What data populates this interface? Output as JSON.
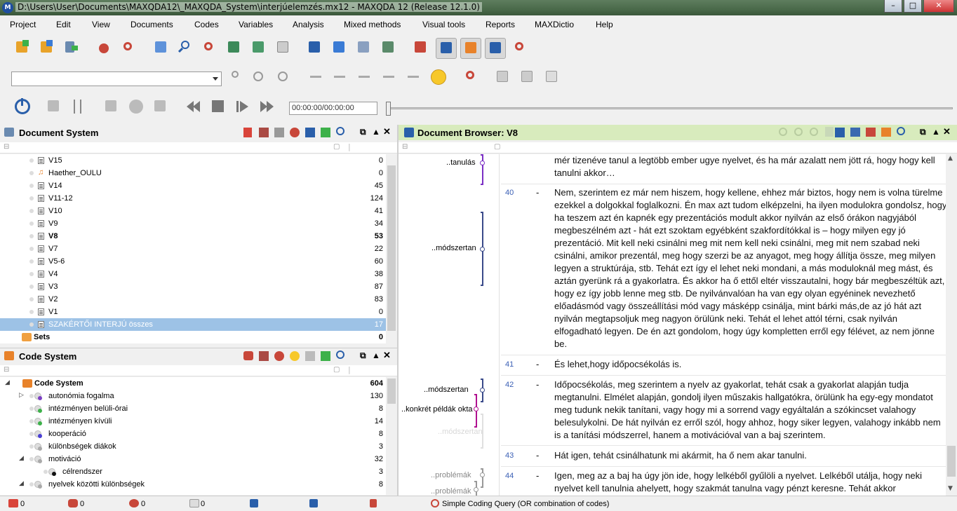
{
  "window": {
    "title": "D:\\Users\\User\\Documents\\MAXQDA12\\_MAXQDA_System\\interjúelemzés.mx12 - MAXQDA 12  (Release 12.1.0)",
    "minimize": "–",
    "maximize": "□",
    "close": "✕"
  },
  "menu": [
    "Project",
    "Edit",
    "View",
    "Documents",
    "Codes",
    "Variables",
    "Analysis",
    "Mixed methods",
    "Visual tools",
    "Reports",
    "MAXDictio",
    "Help"
  ],
  "media": {
    "time": "00:00:00/00:00:00",
    "progress": 0
  },
  "document_system": {
    "title": "Document System",
    "rows": [
      {
        "label": "V15",
        "count": "0"
      },
      {
        "label": "Haether_OULU",
        "count": "0",
        "audio": true
      },
      {
        "label": "V14",
        "count": "45"
      },
      {
        "label": "V11-12",
        "count": "124"
      },
      {
        "label": "V10",
        "count": "41"
      },
      {
        "label": "V9",
        "count": "34"
      },
      {
        "label": "V8",
        "count": "53",
        "bold": true
      },
      {
        "label": "V7",
        "count": "22"
      },
      {
        "label": "V5-6",
        "count": "60"
      },
      {
        "label": "V4",
        "count": "38"
      },
      {
        "label": "V3",
        "count": "87"
      },
      {
        "label": "V2",
        "count": "83"
      },
      {
        "label": "V1",
        "count": "0"
      },
      {
        "label": "SZAKÉRTŐI INTERJÚ összes",
        "count": "17",
        "selected": true
      },
      {
        "label": "Sets",
        "count": "0",
        "bold": true
      }
    ]
  },
  "code_system": {
    "title": "Code System",
    "rows": [
      {
        "label": "Code System",
        "count": "604",
        "bold": true,
        "color": "#e07020"
      },
      {
        "label": "autonómia fogalma",
        "count": "130",
        "color": "#7b3fc4"
      },
      {
        "label": "intézményen belüli-órai",
        "count": "8",
        "color": "#3db14a"
      },
      {
        "label": "intézményen kívüli",
        "count": "14",
        "color": "#3db14a"
      },
      {
        "label": "kooperáció",
        "count": "8",
        "color": "#4a3fd4"
      },
      {
        "label": "különbségek diákok",
        "count": "3",
        "color": "#aaaaaa"
      },
      {
        "label": "motiváció",
        "count": "32",
        "color": "#aaaaaa"
      },
      {
        "label": "célrendszer",
        "count": "3",
        "color": "#111111"
      },
      {
        "label": "nyelvek közötti különbségek",
        "count": "8",
        "color": "#aaaaaa"
      }
    ]
  },
  "document_browser": {
    "title": "Document Browser: V8",
    "codes": [
      {
        "label": "..tanulás",
        "color": "#7b2fc4"
      },
      {
        "label": "..módszertan",
        "color": "#3a4a8a"
      },
      {
        "label": "..módszertan",
        "color": "#3a4a8a"
      },
      {
        "label": "..konkrét példák okta",
        "color": "#b01090"
      },
      {
        "label": "..módszertan",
        "color": "#d8d8d8"
      },
      {
        "label": "..problémák",
        "color": "#888888"
      },
      {
        "label": "..problémák",
        "color": "#888888"
      }
    ],
    "paragraphs": [
      {
        "num": "",
        "dash": "",
        "text": "mér tizenéve tanul a legtöbb ember ugye nyelvet, és ha már azalatt nem jött rá, hogy hogy kell tanulni akkor…"
      },
      {
        "num": "40",
        "dash": "-",
        "text": "Nem, szerintem ez már nem hiszem, hogy kellene, ehhez már biztos, hogy nem is volna türelme ezekkel a dolgokkal foglalkozni. Én max azt tudom elképzelni, ha ilyen modulokra gondolsz, hogy ha teszem azt én kapnék egy prezentációs modult akkor nyilván az első órákon nagyjából megbeszélném azt  - hát ezt szoktam egyébként szakfordítókkal is – hogy milyen egy jó prezentáció. Mit kell neki csinálni meg mit nem kell neki csinálni, meg mit nem szabad neki csinálni, amikor prezentál, meg hogy szerzi be az anyagot, meg hogy állítja össze, meg milyen legyen a struktúrája, stb. Tehát ezt így el lehet neki mondani, a más moduloknál meg mást, és aztán gyerünk rá a gyakorlatra. És akkor ha ő ettől eltér visszautalni, hogy bár megbeszéltük azt, hogy ez így jobb lenne meg stb. De nyilvánvalóan ha van egy olyan egyéninek nevezhető előadásmód vagy összeállítási mód vagy másképp csinálja, mint bárki más,de az jó hát azt nyilván megtapsoljuk meg nagyon örülünk neki. Tehát el lehet attól térni, csak nyilván elfogadható legyen. De én azt gondolom, hogy úgy kompletten erről egy félévet, az nem jönne be."
      },
      {
        "num": "41",
        "dash": "-",
        "text": "És lehet,hogy időpocsékolás is."
      },
      {
        "num": "42",
        "dash": "-",
        "text": "Időpocsékolás, meg szerintem a nyelv az gyakorlat, tehát csak a gyakorlat alapján tudja megtanulni. Elmélet alapján, gondolj ilyen műszakis hallgatókra, örülünk ha egy-egy mondatot meg tudunk nekik tanítani, vagy hogy mi a sorrend vagy egyáltalán a szókincset valahogy belesulykolni. De hát nyilván ez erről szól, hogy ahhoz, hogy siker legyen, valahogy inkább nem is a tanítási módszerrel, hanem a motivációval van a baj szerintem."
      },
      {
        "num": "43",
        "dash": "-",
        "text": "Hát igen, tehát csinálhatunk mi akármit, ha ő nem akar tanulni."
      },
      {
        "num": "44",
        "dash": "-",
        "text": "Igen, meg az a baj ha úgy jön ide, hogy lelkéből gyűlöli a nyelvet. Lelkéből utálja, hogy neki nyelvet kell tanulnia ahelyett, hogy szakmát tanulna vagy pénzt keresne. Tehát akkor"
      }
    ]
  },
  "status": {
    "items": [
      "0",
      "0",
      "0",
      "0"
    ],
    "query": "Simple Coding Query (OR combination of codes)"
  }
}
